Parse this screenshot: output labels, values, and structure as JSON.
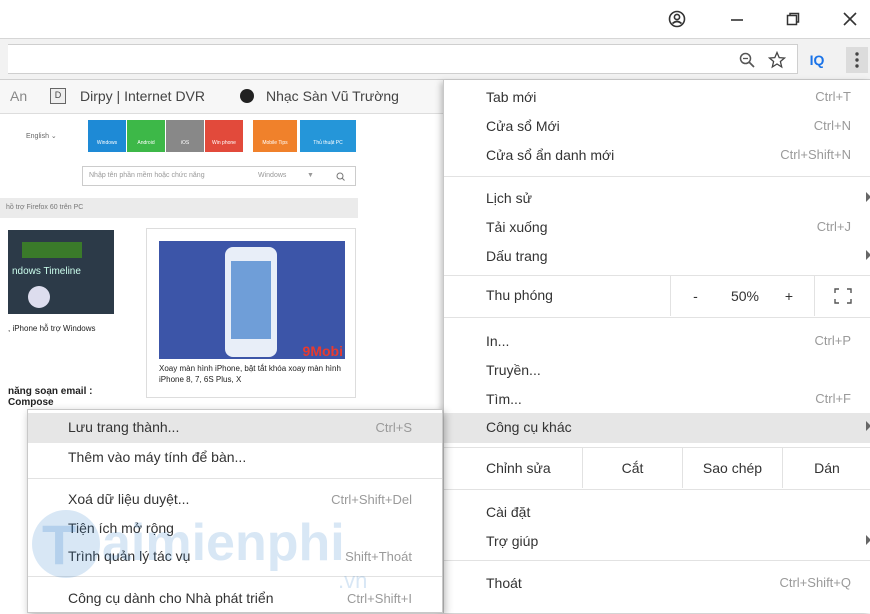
{
  "toolbar": {
    "extension_label": "IQ"
  },
  "bookmarks": [
    {
      "label": "An",
      "icon": "page-icon"
    },
    {
      "label": "Dirpy | Internet DVR",
      "icon": "dirpy-icon"
    },
    {
      "label": "Nhạc Sàn Vũ Trường",
      "icon": "music-icon"
    }
  ],
  "page": {
    "language": "English",
    "categories": [
      "Windows",
      "Android",
      "iOS",
      "Win phone",
      "Mobile Tips",
      "Thủ thuật PC"
    ],
    "category_colors": [
      "#1e8ad6",
      "#3db848",
      "#888888",
      "#e24a3b",
      "#f0812b",
      "#2596d9"
    ],
    "search_placeholder": "Nhập tên phần mềm hoặc chức năng",
    "search_filter": "Windows",
    "breadcrumb": "hồ trợ Firefox 60 trên PC",
    "left_thumb_text": "ndows Timeline",
    "left_caption": ", iPhone hỗ trợ Windows",
    "card_badge": "9Mobi",
    "card_caption": "Xoay màn hình iPhone, bật tắt khóa xoay màn hình iPhone 8, 7, 6S Plus, X",
    "left_heading": "năng soạn email : Compose",
    "watermark": "Taimienphi.vn"
  },
  "menu": {
    "new_tab": {
      "label": "Tab mới",
      "shortcut": "Ctrl+T"
    },
    "new_window": {
      "label": "Cửa sổ Mới",
      "shortcut": "Ctrl+N"
    },
    "incognito": {
      "label": "Cửa sổ ẩn danh mới",
      "shortcut": "Ctrl+Shift+N"
    },
    "history": {
      "label": "Lịch sử"
    },
    "downloads": {
      "label": "Tải xuống",
      "shortcut": "Ctrl+J"
    },
    "bookmarks": {
      "label": "Dấu trang"
    },
    "zoom": {
      "label": "Thu phóng",
      "minus": "-",
      "value": "50%",
      "plus": "+"
    },
    "print": {
      "label": "In...",
      "shortcut": "Ctrl+P"
    },
    "cast": {
      "label": "Truyền..."
    },
    "find": {
      "label": "Tìm...",
      "shortcut": "Ctrl+F"
    },
    "more_tools": {
      "label": "Công cụ khác"
    },
    "edit": {
      "label": "Chỉnh sửa",
      "cut": "Cắt",
      "copy": "Sao chép",
      "paste": "Dán"
    },
    "settings": {
      "label": "Cài đặt"
    },
    "help": {
      "label": "Trợ giúp"
    },
    "exit": {
      "label": "Thoát",
      "shortcut": "Ctrl+Shift+Q"
    }
  },
  "submenu": {
    "save_page": {
      "label": "Lưu trang thành...",
      "shortcut": "Ctrl+S"
    },
    "add_desktop": {
      "label": "Thêm vào máy tính để bàn..."
    },
    "clear_data": {
      "label": "Xoá dữ liệu duyệt...",
      "shortcut": "Ctrl+Shift+Del"
    },
    "extensions": {
      "label": "Tiện ích mở rộng"
    },
    "task_manager": {
      "label": "Trình quản lý tác vụ",
      "shortcut": "Shift+Thoát"
    },
    "dev_tools": {
      "label": "Công cụ dành cho Nhà phát triển",
      "shortcut": "Ctrl+Shift+I"
    }
  }
}
